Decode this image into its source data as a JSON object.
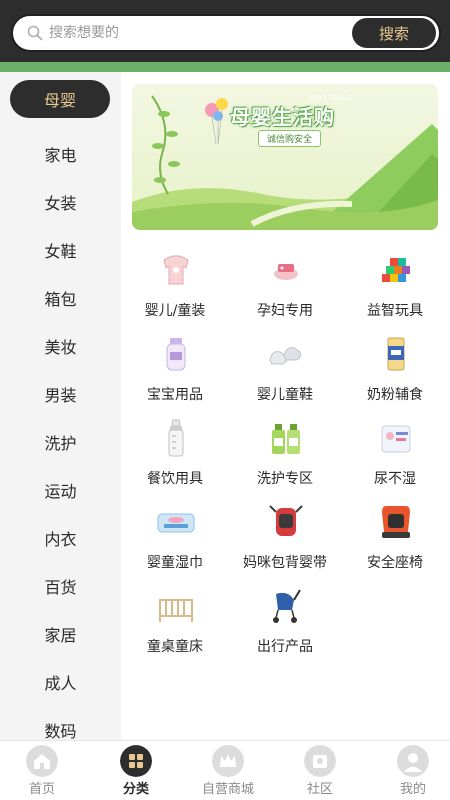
{
  "search": {
    "placeholder": "搜索想要的",
    "button_label": "搜索"
  },
  "sidebar": {
    "items": [
      {
        "label": "母婴",
        "active": true
      },
      {
        "label": "家电"
      },
      {
        "label": "女装"
      },
      {
        "label": "女鞋"
      },
      {
        "label": "箱包"
      },
      {
        "label": "美妆"
      },
      {
        "label": "男装"
      },
      {
        "label": "洗护"
      },
      {
        "label": "运动"
      },
      {
        "label": "内衣"
      },
      {
        "label": "百货"
      },
      {
        "label": "家居"
      },
      {
        "label": "成人"
      },
      {
        "label": "数码"
      }
    ]
  },
  "banner": {
    "title": "母婴生活购",
    "hot_text": "HOT SALE",
    "subtitle": "诚信购安全"
  },
  "categories": [
    {
      "label": "婴儿/童装"
    },
    {
      "label": "孕妇专用"
    },
    {
      "label": "益智玩具"
    },
    {
      "label": "宝宝用品"
    },
    {
      "label": "婴儿童鞋"
    },
    {
      "label": "奶粉辅食"
    },
    {
      "label": "餐饮用具"
    },
    {
      "label": "洗护专区"
    },
    {
      "label": "尿不湿"
    },
    {
      "label": "婴童湿巾"
    },
    {
      "label": "妈咪包背婴带"
    },
    {
      "label": "安全座椅"
    },
    {
      "label": "童桌童床"
    },
    {
      "label": "出行产品"
    }
  ],
  "bottom_nav": {
    "items": [
      {
        "label": "首页",
        "icon": "home-icon"
      },
      {
        "label": "分类",
        "icon": "category-icon",
        "active": true
      },
      {
        "label": "自营商城",
        "icon": "crown-icon"
      },
      {
        "label": "社区",
        "icon": "community-icon"
      },
      {
        "label": "我的",
        "icon": "profile-icon"
      }
    ]
  },
  "colors": {
    "header_dark": "#2d2d2d",
    "accent_gold": "#e7c98f",
    "accent_green": "#6ab06a",
    "sidebar_bg": "#f4f4f4"
  }
}
